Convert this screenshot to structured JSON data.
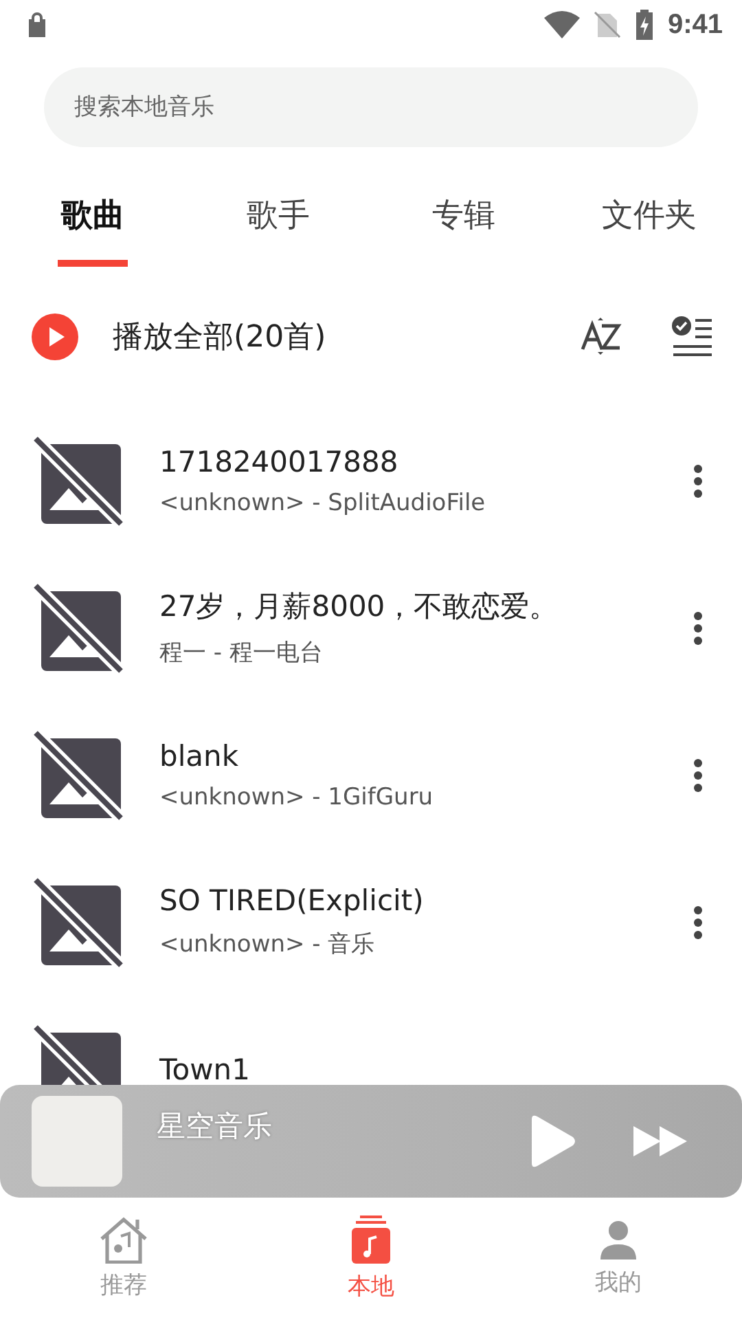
{
  "status_bar": {
    "time": "9:41"
  },
  "search": {
    "placeholder": "搜索本地音乐"
  },
  "tabs": [
    {
      "label": "歌曲",
      "selected": true
    },
    {
      "label": "歌手",
      "selected": false
    },
    {
      "label": "专辑",
      "selected": false
    },
    {
      "label": "文件夹",
      "selected": false
    }
  ],
  "play_all": {
    "label": "播放全部(20首)"
  },
  "songs": [
    {
      "title": "1718240017888",
      "subtitle": "<unknown> - SplitAudioFile",
      "more": true
    },
    {
      "title": "27岁，月薪8000，不敢恋爱。",
      "subtitle": "程一 - 程一电台",
      "more": true
    },
    {
      "title": "blank",
      "subtitle": "<unknown> - 1GifGuru",
      "more": true
    },
    {
      "title": "SO TIRED(Explicit)",
      "subtitle": "<unknown> - 音乐",
      "more": true
    },
    {
      "title": "Town1",
      "more": false
    }
  ],
  "mini_player": {
    "title": "星空音乐"
  },
  "bottom_nav": [
    {
      "label": "推荐",
      "kind": "home",
      "selected": false
    },
    {
      "label": "本地",
      "kind": "local",
      "selected": true
    },
    {
      "label": "我的",
      "kind": "profile",
      "selected": false
    }
  ]
}
